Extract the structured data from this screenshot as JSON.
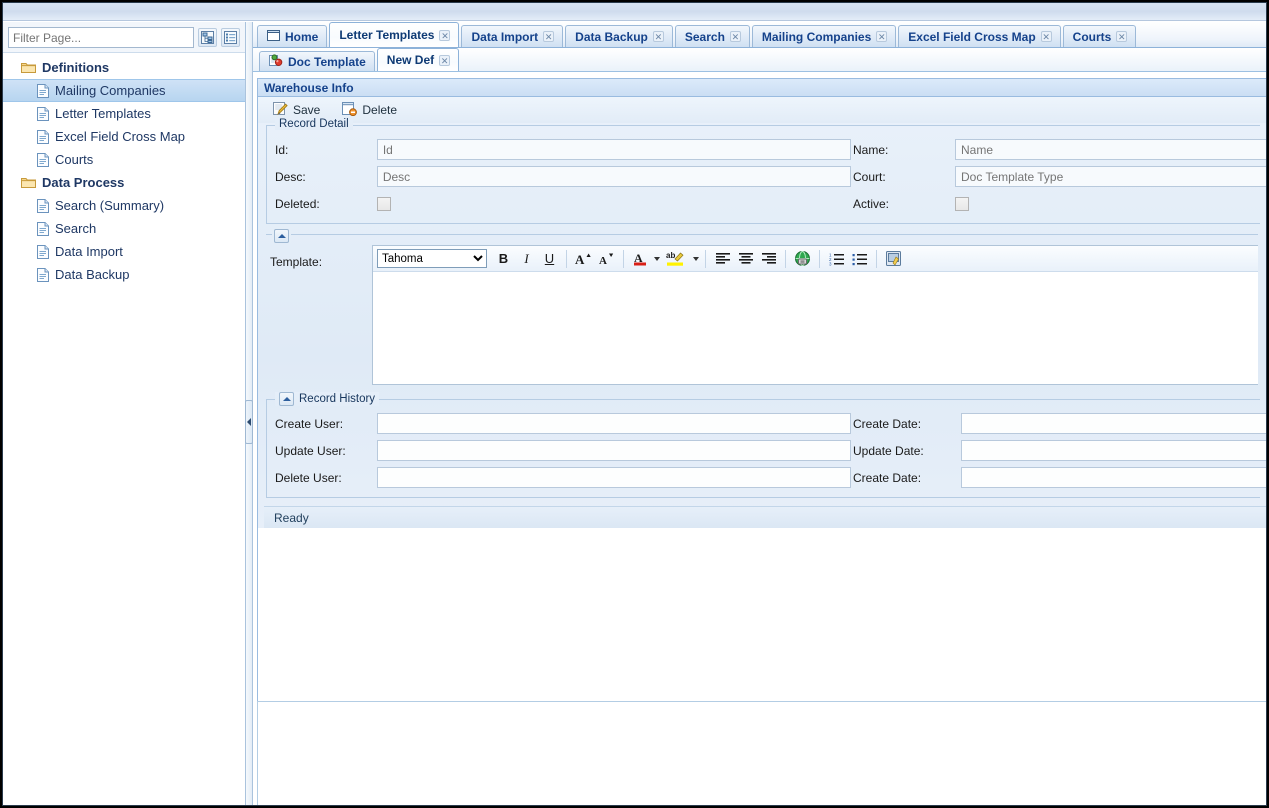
{
  "window": {
    "title": ""
  },
  "nav": {
    "filter": {
      "placeholder": "Filter Page...",
      "value": ""
    },
    "tools": [
      {
        "name": "expand-tree-icon",
        "label": "Expand All"
      },
      {
        "name": "collapse-tree-icon",
        "label": "Collapse All"
      }
    ],
    "groups": [
      {
        "label": "Definitions",
        "items": [
          {
            "label": "Mailing Companies",
            "selected": true
          },
          {
            "label": "Letter Templates",
            "selected": false
          },
          {
            "label": "Excel Field Cross Map",
            "selected": false
          },
          {
            "label": "Courts",
            "selected": false
          }
        ]
      },
      {
        "label": "Data Process",
        "items": [
          {
            "label": "Search (Summary)",
            "selected": false
          },
          {
            "label": "Search",
            "selected": false
          },
          {
            "label": "Data Import",
            "selected": false
          },
          {
            "label": "Data Backup",
            "selected": false
          }
        ]
      }
    ]
  },
  "tabs_outer": [
    {
      "label": "Home",
      "active": false,
      "closable": false,
      "icon": "home-window-icon"
    },
    {
      "label": "Letter Templates",
      "active": true,
      "closable": true
    },
    {
      "label": "Data Import",
      "active": false,
      "closable": true
    },
    {
      "label": "Data Backup",
      "active": false,
      "closable": true
    },
    {
      "label": "Search",
      "active": false,
      "closable": true
    },
    {
      "label": "Mailing Companies",
      "active": false,
      "closable": true
    },
    {
      "label": "Excel Field Cross Map",
      "active": false,
      "closable": true
    },
    {
      "label": "Courts",
      "active": false,
      "closable": true
    }
  ],
  "tabs_inner": [
    {
      "label": "Doc Template",
      "active": false,
      "closable": false,
      "icon": "doc-template-icon"
    },
    {
      "label": "New Def",
      "active": true,
      "closable": true
    }
  ],
  "panel": {
    "title": "Warehouse Info",
    "toolbar": [
      {
        "label": "Save",
        "icon": "save-pencil-icon"
      },
      {
        "label": "Delete",
        "icon": "delete-page-icon"
      }
    ],
    "record_detail": {
      "legend": "Record Detail",
      "fields_left": [
        {
          "label": "Id:",
          "type": "text",
          "placeholder": "Id",
          "value": ""
        },
        {
          "label": "Desc:",
          "type": "text",
          "placeholder": "Desc",
          "value": ""
        },
        {
          "label": "Deleted:",
          "type": "checkbox",
          "checked": false
        }
      ],
      "fields_right": [
        {
          "label": "Name:",
          "type": "text",
          "placeholder": "Name",
          "value": ""
        },
        {
          "label": "Court:",
          "type": "text",
          "placeholder": "Doc Template Type",
          "value": ""
        },
        {
          "label": "Active:",
          "type": "checkbox",
          "checked": false
        }
      ]
    },
    "template_section": {
      "label": "Template:",
      "collapse_icon": "collapse-up-icon",
      "editor": {
        "font_selected": "Tahoma",
        "font_options": [
          "Tahoma"
        ],
        "buttons": [
          {
            "name": "bold-icon",
            "glyph": "B"
          },
          {
            "name": "italic-icon",
            "glyph": "I"
          },
          {
            "name": "underline-icon",
            "glyph": "U"
          },
          {
            "name": "increase-font-size-icon",
            "glyph": "A"
          },
          {
            "name": "decrease-font-size-icon",
            "glyph": "A"
          },
          {
            "name": "font-color-icon",
            "glyph": "A"
          },
          {
            "name": "highlight-color-icon",
            "glyph": "ab"
          },
          {
            "name": "align-left-icon",
            "glyph": ""
          },
          {
            "name": "align-center-icon",
            "glyph": ""
          },
          {
            "name": "align-right-icon",
            "glyph": ""
          },
          {
            "name": "hyperlink-icon",
            "glyph": ""
          },
          {
            "name": "numbered-list-icon",
            "glyph": ""
          },
          {
            "name": "bulleted-list-icon",
            "glyph": ""
          },
          {
            "name": "source-edit-icon",
            "glyph": ""
          }
        ]
      },
      "content": ""
    },
    "record_history": {
      "legend": "Record History",
      "collapse_icon": "collapse-up-icon",
      "fields_left": [
        {
          "label": "Create User:",
          "value": ""
        },
        {
          "label": "Update User:",
          "value": ""
        },
        {
          "label": "Delete User:",
          "value": ""
        }
      ],
      "fields_right": [
        {
          "label": "Create Date:",
          "value": ""
        },
        {
          "label": "Update Date:",
          "value": ""
        },
        {
          "label": "Create Date:",
          "value": ""
        }
      ]
    },
    "status": "Ready"
  },
  "colors": {
    "accent": "#15428b",
    "panel_header_bg": "#cbdef4",
    "selection": "#b7d5f0",
    "border": "#99bbe0"
  }
}
